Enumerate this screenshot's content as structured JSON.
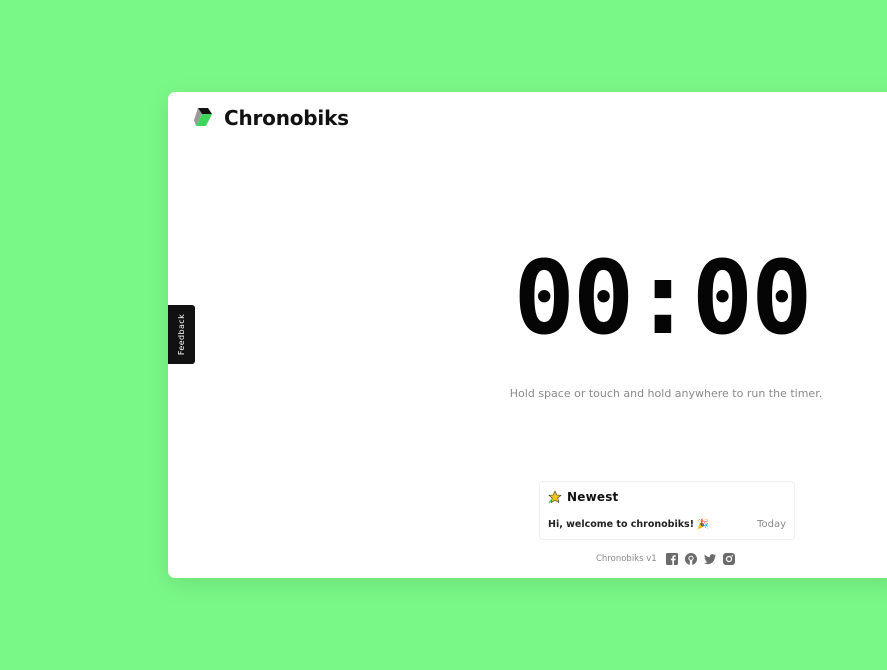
{
  "brand": {
    "name": "Chronobiks",
    "logo_icon": "cube-logo-icon"
  },
  "feedback": {
    "label": "Feedback"
  },
  "timer": {
    "display": "00:00",
    "hint": "Hold space or touch and hold anywhere to run the timer."
  },
  "news": {
    "title": "Newest",
    "icon": "star-icon",
    "items": [
      {
        "text": "Hi, welcome to chronobiks! 🎉",
        "date": "Today"
      }
    ]
  },
  "footer": {
    "version": "Chronobiks v1",
    "social": [
      "facebook-icon",
      "github-icon",
      "twitter-icon",
      "instagram-icon"
    ]
  },
  "colors": {
    "background": "#7af887",
    "accent_green": "#3dd65a",
    "text_dark": "#111111",
    "text_muted": "#8a8a8a"
  }
}
